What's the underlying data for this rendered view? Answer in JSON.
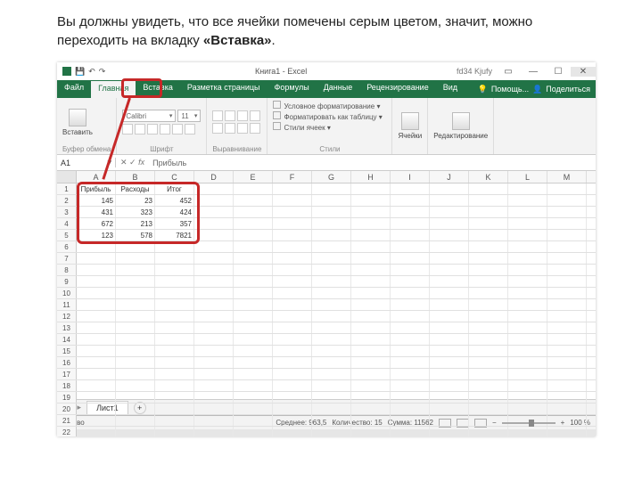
{
  "instruction": {
    "text_a": "Вы должны увидеть, что все ячейки помечены серым цветом, значит, можно переходить на вкладку ",
    "text_b": "«Вставка»",
    "text_c": "."
  },
  "titlebar": {
    "title": "Книга1 - Excel",
    "user": "fd34 Kjufy"
  },
  "tabs": [
    "Файл",
    "Главная",
    "Вставка",
    "Разметка страницы",
    "Формулы",
    "Данные",
    "Рецензирование",
    "Вид"
  ],
  "tabs_active_index": 1,
  "tabs_right": {
    "tell": "Помощь...",
    "share": "Поделиться"
  },
  "ribbon": {
    "clipboard": {
      "paste": "Вставить",
      "title": "Буфер обмена"
    },
    "font": {
      "name": "Calibri",
      "size": "11",
      "title": "Шрифт"
    },
    "align": {
      "title": "Выравнивание"
    },
    "styles": {
      "conditional": "Условное форматирование",
      "table": "Форматировать как таблицу",
      "cellstyles": "Стили ячеек",
      "title": "Стили"
    },
    "cells": {
      "label": "Ячейки"
    },
    "editing": {
      "label": "Редактирование"
    }
  },
  "fbar": {
    "name": "A1",
    "formula": "Прибыль"
  },
  "columns": [
    "A",
    "B",
    "C",
    "D",
    "E",
    "F",
    "G",
    "H",
    "I",
    "J",
    "K",
    "L",
    "M"
  ],
  "row_count": 24,
  "table": {
    "headers": [
      "Прибыль",
      "Расходы",
      "Итог"
    ],
    "rows": [
      [
        145,
        23,
        452
      ],
      [
        431,
        323,
        424
      ],
      [
        672,
        213,
        357
      ],
      [
        123,
        578,
        7821
      ]
    ]
  },
  "sheetbar": {
    "tab": "Лист1"
  },
  "statusbar": {
    "ready": "Готово",
    "avg_label": "Среднее:",
    "avg_value": "963,5",
    "count_label": "Количество:",
    "count_value": "15",
    "sum_label": "Сумма:",
    "sum_value": "11562",
    "zoom": "100 %"
  }
}
